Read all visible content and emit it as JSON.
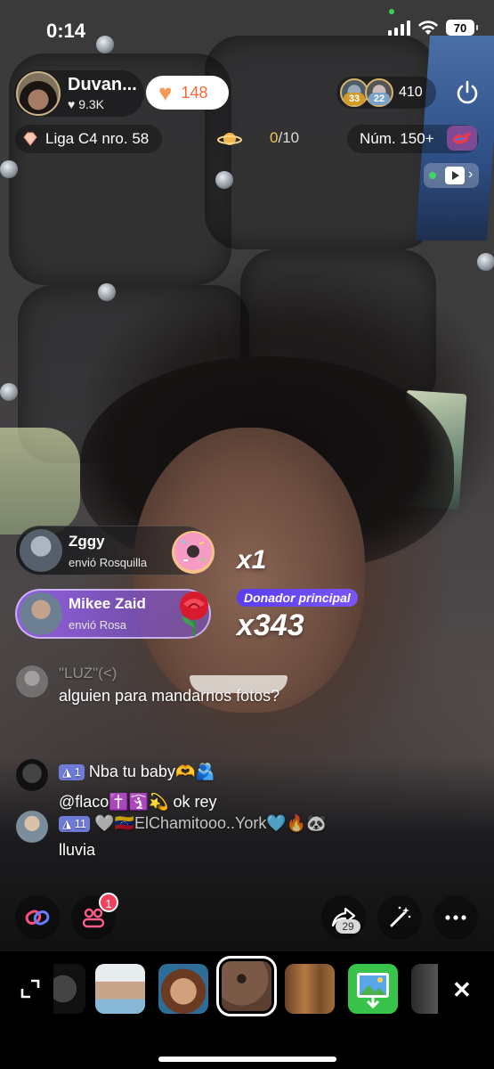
{
  "status_bar": {
    "time": "0:14",
    "battery": "70"
  },
  "host": {
    "name": "Duvan...",
    "likes": "9.3K",
    "hearts": "148"
  },
  "viewers": {
    "avatar_badges": [
      "33",
      "22"
    ],
    "count": "410"
  },
  "league": {
    "label": "Liga C4 nro. 58",
    "progress_current": "0",
    "progress_total": "/10"
  },
  "rank": {
    "label": "Núm. 150+"
  },
  "gifts": [
    {
      "name": "Zggy",
      "action": "envió Rosquilla",
      "count": "x1",
      "gift_icon": "donut-icon"
    },
    {
      "name": "Mikee Zaid",
      "action": "envió Rosa",
      "count": "x343",
      "gift_icon": "rose-icon",
      "tag": "Donador principal"
    }
  ],
  "chat": [
    {
      "user": "\"LUZ\"(<)",
      "message": "alguien para mandarnos fotos?"
    },
    {
      "level": "1",
      "message": "Nba tu baby🫶🫂"
    },
    {
      "message": "@flaco✝️🛐💫 ok rey"
    },
    {
      "level": "11",
      "user": "🤍🇻🇪ElChamitooo..York🩵🔥🐼",
      "message": "lluvia"
    }
  ],
  "controls": {
    "guests_badge": "1",
    "share_count": "29"
  },
  "colors": {
    "heart": "#f39a57",
    "accent_purple": "#7a55f7",
    "badge_red": "#f1425d"
  }
}
